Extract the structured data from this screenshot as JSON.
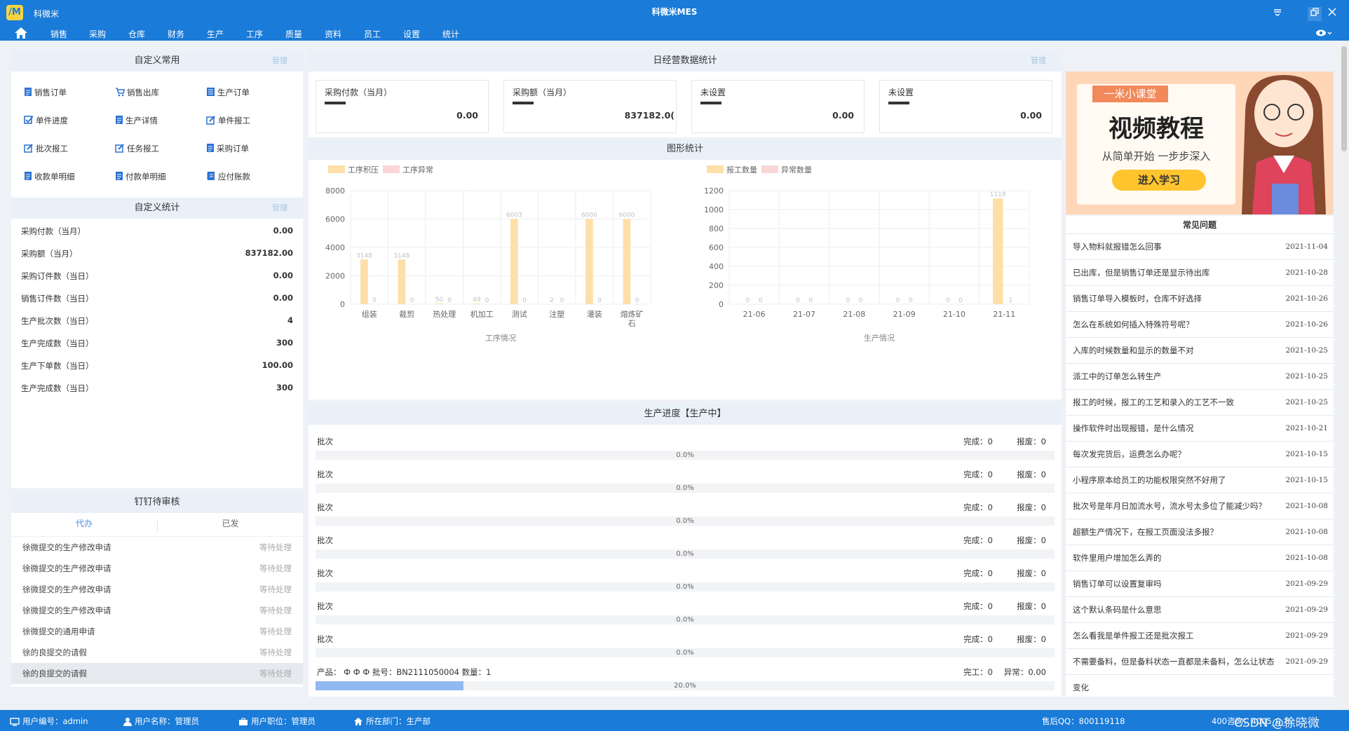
{
  "window": {
    "app_name": "科微米",
    "title": "科微米MES",
    "logo_text": "/M"
  },
  "menu": [
    "销售",
    "采购",
    "仓库",
    "财务",
    "生产",
    "工序",
    "质量",
    "资料",
    "员工",
    "设置",
    "统计"
  ],
  "custom_common": {
    "title": "自定义常用",
    "manage": "管理",
    "items": [
      "销售订单",
      "销售出库",
      "生产订单",
      "单件进度",
      "生产详情",
      "单件报工",
      "批次报工",
      "任务报工",
      "采购订单",
      "收款单明细",
      "付款单明细",
      "应付账款"
    ]
  },
  "custom_stats": {
    "title": "自定义统计",
    "manage": "管理",
    "rows": [
      {
        "label": "采购付款（当月）",
        "value": "0.00"
      },
      {
        "label": "采购额（当月）",
        "value": "837182.00"
      },
      {
        "label": "采购订件数（当日）",
        "value": "0.00"
      },
      {
        "label": "销售订件数（当日）",
        "value": "0.00"
      },
      {
        "label": "生产批次数（当日）",
        "value": "4"
      },
      {
        "label": "生产完成数（当日）",
        "value": "300"
      },
      {
        "label": "生产下单数（当日）",
        "value": "100.00"
      },
      {
        "label": "生产完成数（当日）",
        "value": "300"
      }
    ]
  },
  "dingding": {
    "title": "钉钉待审核",
    "tabs": [
      "代办",
      "已发"
    ],
    "rows": [
      {
        "text": "徐微提交的生产修改申请",
        "status": "等待处理"
      },
      {
        "text": "徐微提交的生产修改申请",
        "status": "等待处理"
      },
      {
        "text": "徐微提交的生产修改申请",
        "status": "等待处理"
      },
      {
        "text": "徐微提交的生产修改申请",
        "status": "等待处理"
      },
      {
        "text": "徐微提交的通用申请",
        "status": "等待处理"
      },
      {
        "text": "徐的良提交的请假",
        "status": "等待处理"
      },
      {
        "text": "徐的良提交的请假",
        "status": "等待处理"
      }
    ]
  },
  "daily": {
    "title": "日经营数据统计",
    "manage": "管理",
    "cards": [
      {
        "title": "采购付款（当月）",
        "value": "0.00"
      },
      {
        "title": "采购额（当月）",
        "value": "837182.0("
      },
      {
        "title": "未设置",
        "value": "0.00"
      },
      {
        "title": "未设置",
        "value": "0.00"
      }
    ]
  },
  "graph_title": "图形统计",
  "chart_data": [
    {
      "type": "bar",
      "xlabel": "工序情况",
      "ylim": [
        0,
        8000
      ],
      "yticks": [
        0,
        2000,
        4000,
        6000,
        8000
      ],
      "categories": [
        "组装",
        "裁剪",
        "热处理",
        "机加工",
        "测试",
        "注塑",
        "灌装",
        "熔炼矿石"
      ],
      "tick_labels": [
        "组装",
        "裁剪",
        "热处理",
        "机加工",
        "测试",
        "注塑",
        "灌装",
        "熔炼矿\n石"
      ],
      "series": [
        {
          "name": "工序积压",
          "color": "#fddfa8",
          "values": [
            3148,
            3148,
            50,
            49,
            6003,
            2,
            6000,
            6000
          ]
        },
        {
          "name": "工序异常",
          "color": "#fbd6d6",
          "values": [
            0,
            0,
            0,
            0,
            0,
            0,
            0,
            0
          ]
        }
      ],
      "legend": "top-left"
    },
    {
      "type": "bar",
      "xlabel": "生产情况",
      "ylim": [
        0,
        1200
      ],
      "yticks": [
        0,
        200,
        400,
        600,
        800,
        1000,
        1200
      ],
      "categories": [
        "21-06",
        "21-07",
        "21-08",
        "21-09",
        "21-10",
        "21-11"
      ],
      "series": [
        {
          "name": "报工数量",
          "color": "#fddfa8",
          "values": [
            0,
            0,
            0,
            0,
            0,
            1118
          ]
        },
        {
          "name": "异常数量",
          "color": "#fbd6d6",
          "values": [
            0,
            0,
            0,
            0,
            0,
            1
          ]
        }
      ],
      "legend": "top-left"
    }
  ],
  "progress": {
    "title": "生产进度【生产中】",
    "rows": [
      {
        "label": "批次",
        "done": "完成：0",
        "bad": "报废：0",
        "pct": "0.0%",
        "fill": 0
      },
      {
        "label": "批次",
        "done": "完成：0",
        "bad": "报废：0",
        "pct": "0.0%",
        "fill": 0
      },
      {
        "label": "批次",
        "done": "完成：0",
        "bad": "报废：0",
        "pct": "0.0%",
        "fill": 0
      },
      {
        "label": "批次",
        "done": "完成：0",
        "bad": "报废：0",
        "pct": "0.0%",
        "fill": 0
      },
      {
        "label": "批次",
        "done": "完成：0",
        "bad": "报废：0",
        "pct": "0.0%",
        "fill": 0
      },
      {
        "label": "批次",
        "done": "完成：0",
        "bad": "报废：0",
        "pct": "0.0%",
        "fill": 0
      },
      {
        "label": "批次",
        "done": "完成：0",
        "bad": "报废：0",
        "pct": "0.0%",
        "fill": 0
      },
      {
        "label": "产品：  Ф Ф Ф 批号：BN2111050004 数量：1",
        "done": "完工：0",
        "bad": "异常：0.00",
        "pct": "20.0%",
        "fill": 0.2
      }
    ]
  },
  "banner": {
    "tag": "一米小课堂",
    "title": "视频教程",
    "subtitle": "从简单开始 一步步深入",
    "button": "进入学习"
  },
  "faq": {
    "title": "常见问题",
    "items": [
      {
        "q": "导入物料就报错怎么回事",
        "d": "2021-11-04"
      },
      {
        "q": "已出库，但是销售订单还是显示待出库",
        "d": "2021-10-28"
      },
      {
        "q": "销售订单导入模板时，仓库不好选择",
        "d": "2021-10-26"
      },
      {
        "q": "怎么在系统如何插入特殊符号呢？",
        "d": "2021-10-26"
      },
      {
        "q": "入库的时候数量和显示的数量不对",
        "d": "2021-10-25"
      },
      {
        "q": "派工中的订单怎么转生产",
        "d": "2021-10-25"
      },
      {
        "q": "报工的时候，报工的工艺和录入的工艺不一致",
        "d": "2021-10-25"
      },
      {
        "q": "操作软件时出现报错，是什么情况",
        "d": "2021-10-21"
      },
      {
        "q": "每次发完货后，运费怎么办呢？",
        "d": "2021-10-15"
      },
      {
        "q": "小程序原本给员工的功能权限突然不好用了",
        "d": "2021-10-15"
      },
      {
        "q": "批次号是年月日加流水号，流水号太多位了能减少吗？",
        "d": "2021-10-08"
      },
      {
        "q": "超额生产情况下，在报工页面没法多报？",
        "d": "2021-10-08"
      },
      {
        "q": "软件里用户增加怎么弄的",
        "d": "2021-10-08"
      },
      {
        "q": "销售订单可以设置复审吗",
        "d": "2021-09-29"
      },
      {
        "q": "这个默认条码是什么意思",
        "d": "2021-09-29"
      },
      {
        "q": "怎么看我是单件报工还是批次报工",
        "d": "2021-09-29"
      },
      {
        "q": "不需要备料，但是备料状态一直都是未备料，怎么让状态",
        "d": "2021-09-29"
      }
    ],
    "trailing": "变化"
  },
  "status": {
    "user_no": "用户编号：admin",
    "user_name": "用户名称：管理员",
    "user_pos": "用户职位：管理员",
    "dept": "所在部门：生产部",
    "qq": "售后QQ：800119118",
    "hotline": "400咨询：4005_0_8",
    "watermark": "CSDN @徐晓微"
  }
}
